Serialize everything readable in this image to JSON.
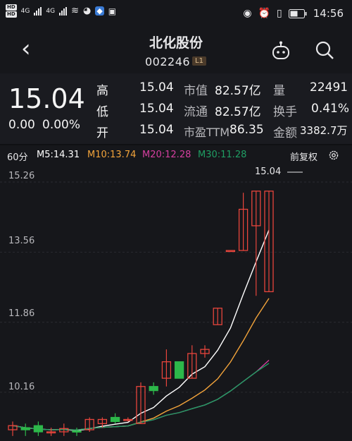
{
  "status": {
    "hd1": "HD",
    "hd2": "HD",
    "net1": "4G",
    "net2": "4G",
    "time": "14:56"
  },
  "nav": {
    "title": "北化股份",
    "code": "002246",
    "level": "L1"
  },
  "quote": {
    "price": "15.04",
    "change": "0.00",
    "change_pct": "0.00%",
    "rows": [
      {
        "l1": "高",
        "v1": "15.04",
        "l2": "市值",
        "v2": "82.57亿",
        "l3": "量",
        "v3": "22491"
      },
      {
        "l1": "低",
        "v1": "15.04",
        "l2": "流通",
        "v2": "82.57亿",
        "l3": "换手",
        "v3": "0.41%"
      },
      {
        "l1": "开",
        "v1": "15.04",
        "l2": "市盈TTM",
        "v2": "86.35",
        "l3": "金额",
        "v3": "3382.7万"
      }
    ]
  },
  "ma_bar": {
    "period": "60分",
    "m5": "M5:14.31",
    "m10": "M10:13.74",
    "m20": "M20:12.28",
    "m30": "M30:11.28",
    "fq": "前复权"
  },
  "colors": {
    "up": "#e8453c",
    "down": "#2db84a",
    "m5": "#ffffff",
    "m10": "#f3a43b",
    "m20": "#d63fa0",
    "m30": "#1f9e63"
  },
  "chart_data": {
    "type": "candlestick",
    "y_ticks": [
      "15.26",
      "13.56",
      "11.86",
      "10.16"
    ],
    "top_label": "15.04",
    "ylim": [
      9.2,
      15.5
    ],
    "candles": [
      {
        "o": 9.25,
        "c": 9.35,
        "h": 9.45,
        "l": 9.1
      },
      {
        "o": 9.3,
        "c": 9.25,
        "h": 9.4,
        "l": 9.1
      },
      {
        "o": 9.35,
        "c": 9.2,
        "h": 9.45,
        "l": 9.1
      },
      {
        "o": 9.2,
        "c": 9.2,
        "h": 9.3,
        "l": 9.1
      },
      {
        "o": 9.2,
        "c": 9.28,
        "h": 9.4,
        "l": 9.1
      },
      {
        "o": 9.22,
        "c": 9.2,
        "h": 9.3,
        "l": 9.1
      },
      {
        "o": 9.25,
        "c": 9.5,
        "h": 9.55,
        "l": 9.2
      },
      {
        "o": 9.4,
        "c": 9.5,
        "h": 9.55,
        "l": 9.3
      },
      {
        "o": 9.55,
        "c": 9.45,
        "h": 9.65,
        "l": 9.4
      },
      {
        "o": 9.5,
        "c": 9.5,
        "h": 9.55,
        "l": 9.45
      },
      {
        "o": 9.4,
        "c": 10.3,
        "h": 10.4,
        "l": 9.4
      },
      {
        "o": 10.3,
        "c": 10.2,
        "h": 10.4,
        "l": 10.1
      },
      {
        "o": 10.5,
        "c": 10.9,
        "h": 11.2,
        "l": 10.3
      },
      {
        "o": 10.9,
        "c": 10.5,
        "h": 10.9,
        "l": 10.5
      },
      {
        "o": 10.5,
        "c": 11.1,
        "h": 11.3,
        "l": 10.5
      },
      {
        "o": 11.1,
        "c": 11.2,
        "h": 11.3,
        "l": 11.0
      },
      {
        "o": 11.8,
        "c": 12.2,
        "h": 12.2,
        "l": 11.8
      },
      {
        "o": 13.6,
        "c": 13.6,
        "h": 13.6,
        "l": 13.6
      },
      {
        "o": 13.6,
        "c": 14.6,
        "h": 15.0,
        "l": 13.6
      },
      {
        "o": 14.2,
        "c": 15.04,
        "h": 15.04,
        "l": 12.5
      },
      {
        "o": 12.6,
        "c": 15.04,
        "h": 15.04,
        "l": 12.6
      }
    ]
  }
}
